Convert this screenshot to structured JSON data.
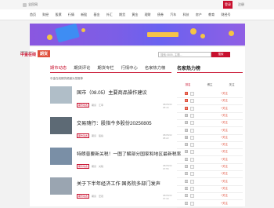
{
  "topbar": {
    "site": "全民网",
    "login": "登录",
    "register": "注册"
  },
  "nav": [
    "首页",
    "财经",
    "股票",
    "行情",
    "新股",
    "基金",
    "外汇",
    "期货",
    "黄金",
    "理财",
    "债券",
    "汽车",
    "科技",
    "房产",
    "教育",
    "财经号"
  ],
  "brand": {
    "name": "中金在线",
    "sub": "CNFOL.com",
    "badge": "期货"
  },
  "search": {
    "placeholder": "搜索:0805, 主题...",
    "button": "搜索"
  },
  "tabs": [
    "期市动态",
    "期货评论",
    "期货专栏",
    "行情中心",
    "名家热力榜"
  ],
  "subhead": "中金在线期货频道为您推荐",
  "articles": [
    {
      "title": "国市（08.05）主要商品操作建议",
      "tag": "期市动态",
      "meta": [
        "期货",
        "汇率"
      ],
      "time": "08/05/22 08:44"
    },
    {
      "title": "交易随行：股指今多股份20250805",
      "tag": "期市动态",
      "meta": [
        "期货",
        "股指"
      ],
      "time": "08/05/22 08:22"
    },
    {
      "title": "特朗普要新关税！一图了解部分国家和地区最新税率",
      "tag": "期市动态",
      "meta": [
        "期货",
        "关税"
      ],
      "time": "08/05/22 07:55"
    },
    {
      "title": "关于下半年经济工作 国务院多部门发声",
      "tag": "期市动态",
      "meta": [
        "期货",
        "宏观"
      ],
      "time": "08/05/22 07:30"
    }
  ],
  "sidebar": {
    "title": "名家热力榜",
    "cols": [
      "排名",
      "博主",
      "关注"
    ],
    "rows": [
      {
        "n": "1",
        "f": "+关注"
      },
      {
        "n": "2",
        "f": "+关注"
      },
      {
        "n": "3",
        "f": "+关注"
      },
      {
        "n": "4",
        "f": "+关注"
      },
      {
        "n": "5",
        "f": "+关注"
      },
      {
        "n": "6",
        "f": "+关注"
      },
      {
        "n": "7",
        "f": "+关注"
      },
      {
        "n": "8",
        "f": "+关注"
      },
      {
        "n": "9",
        "f": "+关注"
      },
      {
        "n": "10",
        "f": "+关注"
      },
      {
        "n": "11",
        "f": "+关注"
      },
      {
        "n": "12",
        "f": "+关注"
      },
      {
        "n": "13",
        "f": "+关注"
      },
      {
        "n": "14",
        "f": "+关注"
      },
      {
        "n": "15",
        "f": "+关注"
      },
      {
        "n": "16",
        "f": "+关注"
      }
    ]
  }
}
